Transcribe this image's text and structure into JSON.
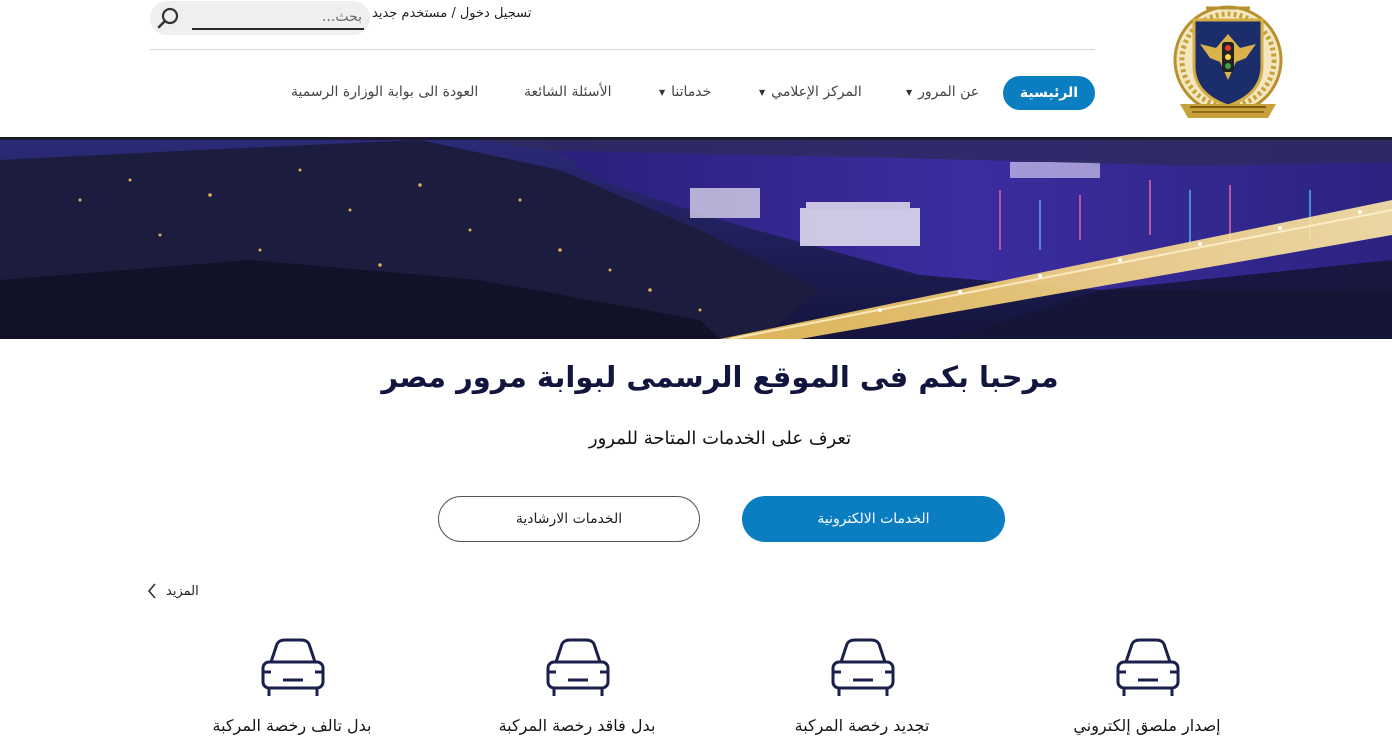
{
  "header": {
    "search": {
      "placeholder": "بحث..."
    },
    "auth": {
      "login": "تسجيل دخول",
      "separator": " / ",
      "register": "مستخدم جديد"
    }
  },
  "nav": {
    "home": "الرئيسية",
    "about": "عن المرور",
    "media": "المركز الإعلامي",
    "services": "خدماتنا",
    "faq": "الأسئلة الشائعة",
    "ministry": "العودة الى بوابة الوزارة الرسمية"
  },
  "welcome": {
    "title": "مرحبا بكم فى الموقع الرسمى لبوابة مرور مصر",
    "subtitle": "تعرف على الخدمات المتاحة للمرور",
    "btn_electronic": "الخدمات الالكترونية",
    "btn_guidance": "الخدمات الارشادية"
  },
  "more": {
    "label": "المزيد"
  },
  "services": [
    {
      "label": "إصدار ملصق إلكتروني"
    },
    {
      "label": "تجديد رخصة المركبة"
    },
    {
      "label": "بدل فاقد رخصة المركبة"
    },
    {
      "label": "بدل تالف رخصة المركبة"
    }
  ],
  "colors": {
    "accent": "#0b7ec2",
    "title": "#12163f",
    "hero_sky": "#2a2a78"
  },
  "icons": {
    "search": "magnifier",
    "service": "car-front",
    "more": "chevron-left"
  }
}
